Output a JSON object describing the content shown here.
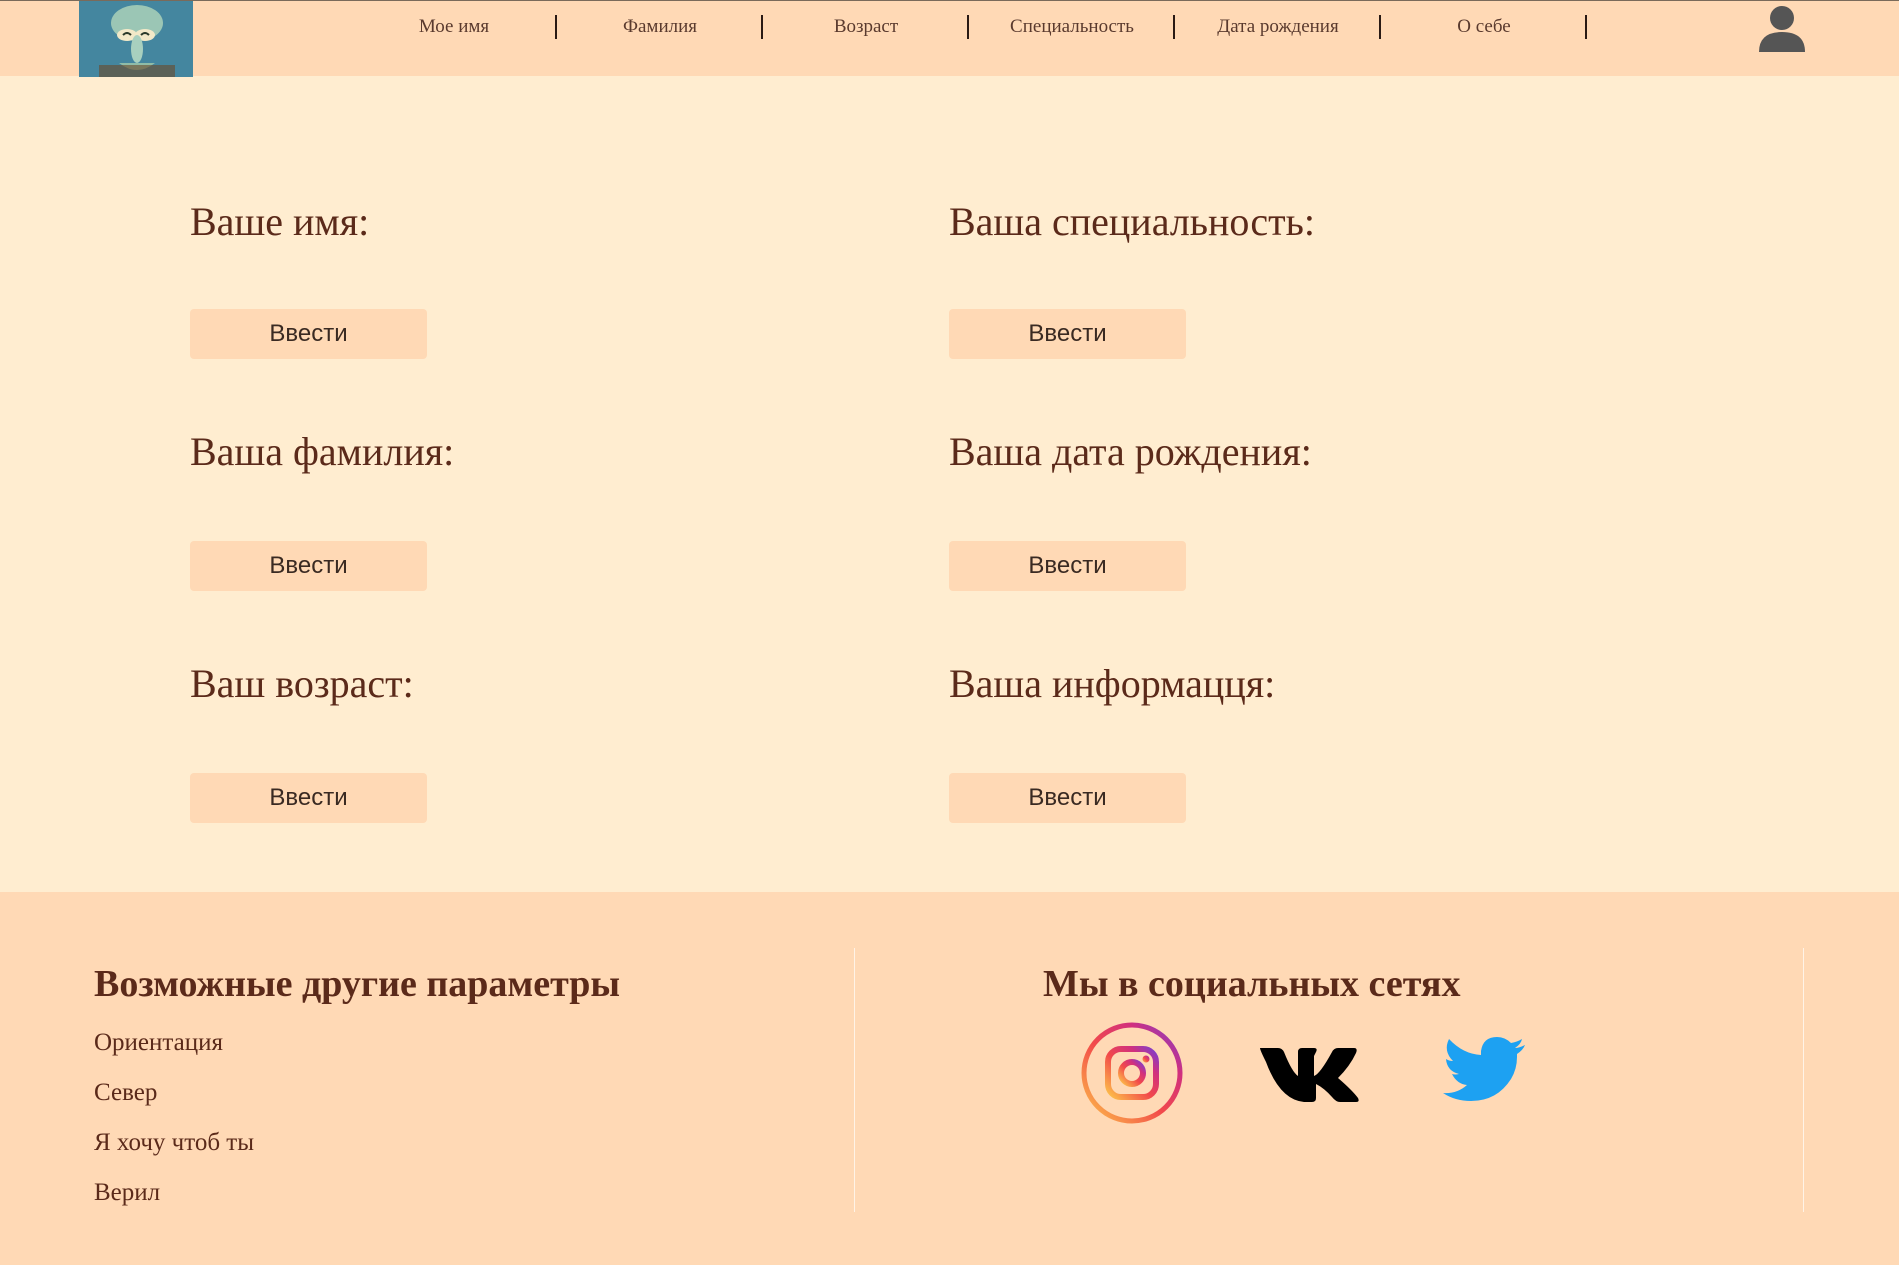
{
  "header": {
    "logo": "character-avatar-logo",
    "nav": [
      "Мое имя",
      "Фамилия",
      "Возраст",
      "Специальность",
      "Дата рождения",
      "О себе"
    ],
    "user_icon": "user-icon"
  },
  "form": {
    "left": [
      {
        "label": "Ваше имя:",
        "button": "Ввести"
      },
      {
        "label": "Ваша фамилия:",
        "button": "Ввести"
      },
      {
        "label": "Ваш возраст:",
        "button": "Ввести"
      }
    ],
    "right": [
      {
        "label": "Ваша специальность:",
        "button": "Ввести"
      },
      {
        "label": "Ваша дата рождения:",
        "button": "Ввести"
      },
      {
        "label": "Ваша информацця:",
        "button": "Ввести"
      }
    ]
  },
  "footer": {
    "params_title": "Возможные другие параметры",
    "params": [
      "Ориентация",
      "Север",
      "Я хочу чтоб ты",
      "Верил"
    ],
    "social_title": "Мы в социальных сетях",
    "social": [
      "instagram-icon",
      "vk-icon",
      "twitter-icon"
    ]
  },
  "colors": {
    "page_bg": "#ffedd0",
    "header_bg": "#ffd9b5",
    "text": "#5b2a1a"
  }
}
